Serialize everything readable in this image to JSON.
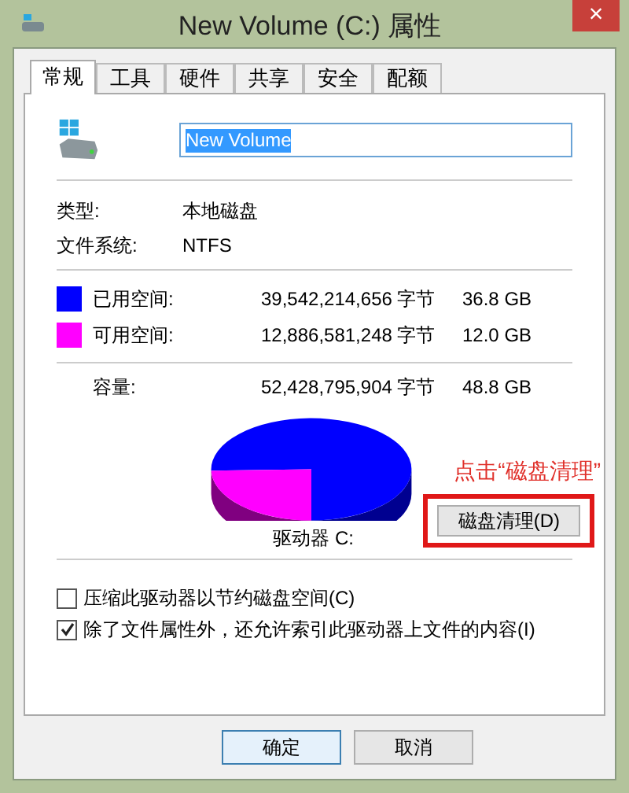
{
  "window": {
    "title": "New Volume (C:) 属性",
    "close": "×"
  },
  "tabs": [
    {
      "label": "常规",
      "selected": true
    },
    {
      "label": "工具",
      "selected": false
    },
    {
      "label": "硬件",
      "selected": false
    },
    {
      "label": "共享",
      "selected": false
    },
    {
      "label": "安全",
      "selected": false
    },
    {
      "label": "配额",
      "selected": false
    }
  ],
  "volume_name": "New Volume",
  "info": [
    {
      "label": "类型:",
      "value": "本地磁盘"
    },
    {
      "label": "文件系统:",
      "value": "NTFS"
    }
  ],
  "space": [
    {
      "label": "已用空间:",
      "bytes": "39,542,214,656 字节",
      "size": "36.8 GB",
      "color": "#0000ff"
    },
    {
      "label": "可用空间:",
      "bytes": "12,886,581,248 字节",
      "size": "12.0 GB",
      "color": "#ff00ff"
    }
  ],
  "capacity": {
    "label": "容量:",
    "bytes": "52,428,795,904 字节",
    "size": "48.8 GB"
  },
  "drive_label": "驱动器 C:",
  "annotation": "点击“磁盘清理”",
  "cleanup_button": "磁盘清理(D)",
  "options": [
    {
      "label": "压缩此驱动器以节约磁盘空间(C)",
      "checked": false
    },
    {
      "label": "除了文件属性外，还允许索引此驱动器上文件的内容(I)",
      "checked": true
    }
  ],
  "buttons": [
    "确定",
    "取消"
  ]
}
